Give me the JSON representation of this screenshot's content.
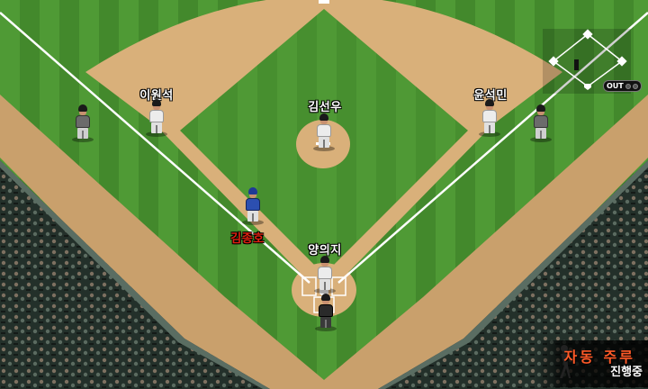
{
  "players": {
    "first_base": "윤석민",
    "third_base": "이원석",
    "pitcher": "김선우",
    "catcher": "양의지",
    "runner": "김종호"
  },
  "scoreboard": {
    "outs_label": "OUT",
    "outs": 0,
    "outs_max": 2
  },
  "status": {
    "mode_label": "자동 주루",
    "progress_label": "진행중"
  },
  "colors": {
    "runner_name": "#e02010",
    "status_accent": "#ff5a28",
    "grass_light": "#4f9a35",
    "grass_dark": "#3f8428",
    "dirt": "#d9b07a"
  }
}
